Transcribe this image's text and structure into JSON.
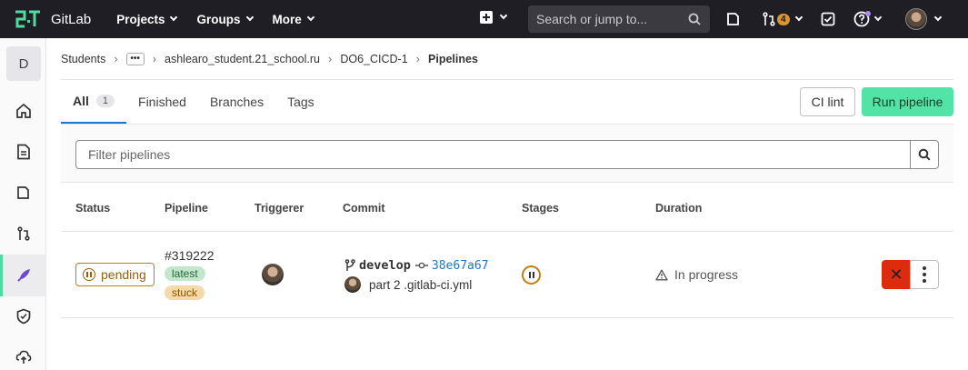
{
  "topbar": {
    "brand": "GitLab",
    "nav": [
      {
        "label": "Projects"
      },
      {
        "label": "Groups"
      },
      {
        "label": "More"
      }
    ],
    "search_placeholder": "Search or jump to...",
    "merge_requests_count": "4",
    "accent_color": "#4fdba0"
  },
  "sidebar": {
    "project_initial": "D",
    "items": [
      "home-icon",
      "document-icon",
      "issues-icon",
      "merge-request-icon",
      "rocket-icon",
      "shield-icon",
      "deploy-icon"
    ]
  },
  "breadcrumb": {
    "items": [
      "Students",
      "ashlearo_student.21_school.ru",
      "DO6_CICD-1"
    ],
    "current": "Pipelines",
    "more": "•••"
  },
  "tabs": [
    {
      "label": "All",
      "count": "1"
    },
    {
      "label": "Finished"
    },
    {
      "label": "Branches"
    },
    {
      "label": "Tags"
    }
  ],
  "actions": {
    "ci_lint": "CI lint",
    "run_pipeline": "Run pipeline"
  },
  "filter": {
    "placeholder": "Filter pipelines"
  },
  "table": {
    "headers": [
      "Status",
      "Pipeline",
      "Triggerer",
      "Commit",
      "Stages",
      "Duration"
    ],
    "rows": [
      {
        "status": "pending",
        "pipeline_id": "#319222",
        "labels": [
          "latest",
          "stuck"
        ],
        "branch": "develop",
        "sha": "38e67a67",
        "commit_message": "part 2 .gitlab-ci.yml",
        "duration": "In progress"
      }
    ]
  }
}
